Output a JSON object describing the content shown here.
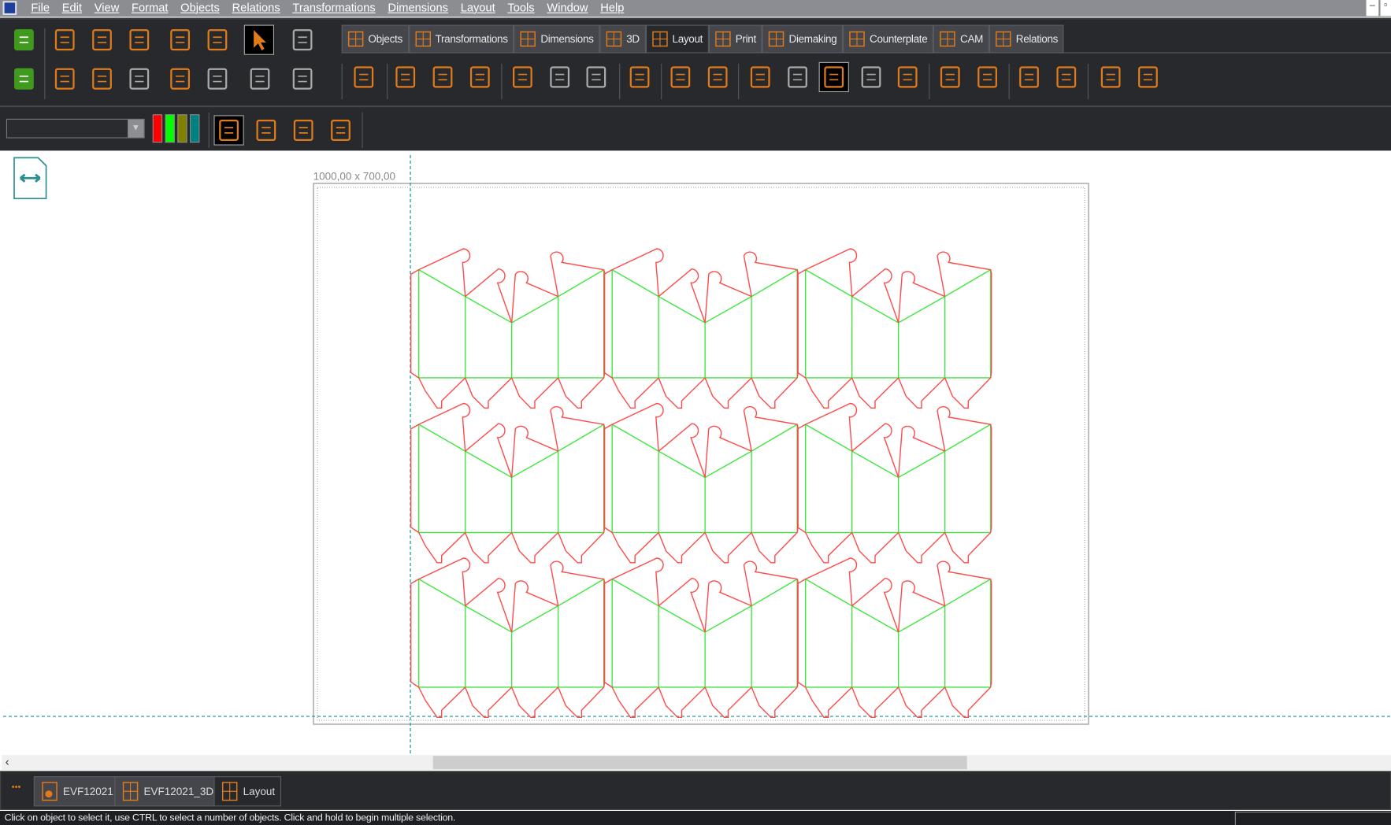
{
  "menu": [
    "File",
    "Edit",
    "View",
    "Format",
    "Objects",
    "Relations",
    "Transformations",
    "Dimensions",
    "Layout",
    "Tools",
    "Window",
    "Help"
  ],
  "ribbon_tabs": [
    {
      "label": "Objects",
      "icon": "objects-icon"
    },
    {
      "label": "Transformations",
      "icon": "transformations-icon"
    },
    {
      "label": "Dimensions",
      "icon": "dimensions-icon"
    },
    {
      "label": "3D",
      "icon": "3d-cube-icon"
    },
    {
      "label": "Layout",
      "icon": "layout-grid-icon",
      "active": true
    },
    {
      "label": "Print",
      "icon": "print-icon"
    },
    {
      "label": "Diemaking",
      "icon": "diemaking-icon"
    },
    {
      "label": "Counterplate",
      "icon": "counterplate-icon"
    },
    {
      "label": "CAM",
      "icon": "cam-icon"
    },
    {
      "label": "Relations",
      "icon": "relations-icon"
    }
  ],
  "canvas": {
    "sheet_size_label": "1000,00 x 700,00",
    "grid_columns": 3,
    "grid_rows": 3,
    "cut_color": "#ff4a4a",
    "crease_color": "#3ee83e",
    "guide_color": "#2a9a9a"
  },
  "color_swatches": [
    "#ff0000",
    "#00ff00",
    "#808000",
    "#008080"
  ],
  "doc_tabs": [
    {
      "label": "EVF12021",
      "icon": "document-icon"
    },
    {
      "label": "EVF12021_3D",
      "icon": "3d-box-icon"
    },
    {
      "label": "Layout",
      "icon": "layout-grid-icon",
      "active": true
    }
  ],
  "doc_tabs_more": "•••",
  "status_text": "Click on object to select it, use CTRL to select a number of objects. Click and hold to begin multiple selection.",
  "accent_color": "#e07b1a"
}
